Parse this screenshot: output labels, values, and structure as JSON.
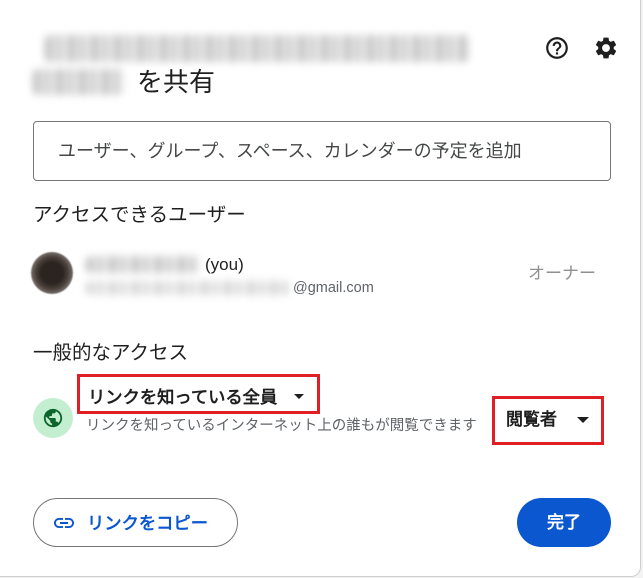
{
  "dialog": {
    "title_suffix": "を共有"
  },
  "search": {
    "placeholder": "ユーザー、グループ、スペース、カレンダーの予定を追加"
  },
  "people": {
    "heading": "アクセスできるユーザー",
    "owner": {
      "name_suffix": "(you)",
      "email_suffix": "@gmail.com",
      "role": "オーナー"
    }
  },
  "general_access": {
    "heading": "一般的なアクセス",
    "scope": "リンクを知っている全員",
    "description": "リンクを知っているインターネット上の誰もが閲覧できます",
    "role": "閲覧者"
  },
  "footer": {
    "copy_link_label": "リンクをコピー",
    "done_label": "完了"
  },
  "icons": {
    "help": "help-icon",
    "settings": "gear-icon",
    "general_access": "globe-icon",
    "copy_link": "link-icon",
    "dropdown": "caret-down-icon"
  },
  "colors": {
    "accent": "#0b57d0",
    "annotation": "#e01e24",
    "globe_background": "#c4eed0",
    "globe_foreground": "#0d652d",
    "text": "#1f1f1f",
    "muted_text": "#5f6368"
  }
}
